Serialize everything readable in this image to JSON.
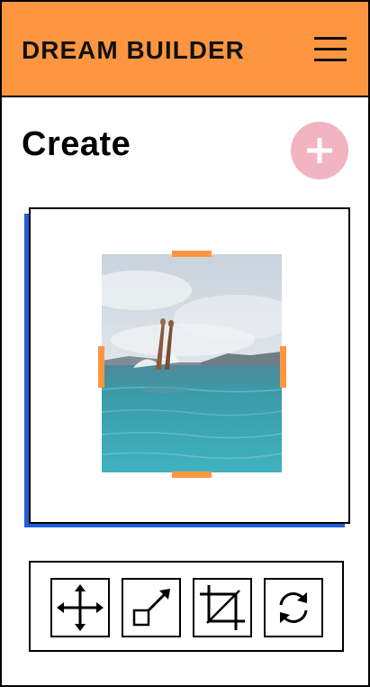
{
  "header": {
    "app_title": "DREAM BUILDER",
    "menu_icon": "hamburger-menu-icon",
    "background_color": "#fe9641"
  },
  "main": {
    "page_title": "Create",
    "add_icon": "plus-icon",
    "add_button_color": "#f3b4c1"
  },
  "canvas": {
    "image_subject": "legs diving into the sea",
    "handle_color": "#fe9641",
    "shadow_color": "#1f5fd6"
  },
  "toolbar": {
    "tools": [
      {
        "icon": "move-icon"
      },
      {
        "icon": "resize-icon"
      },
      {
        "icon": "crop-icon"
      },
      {
        "icon": "rotate-icon"
      }
    ]
  }
}
